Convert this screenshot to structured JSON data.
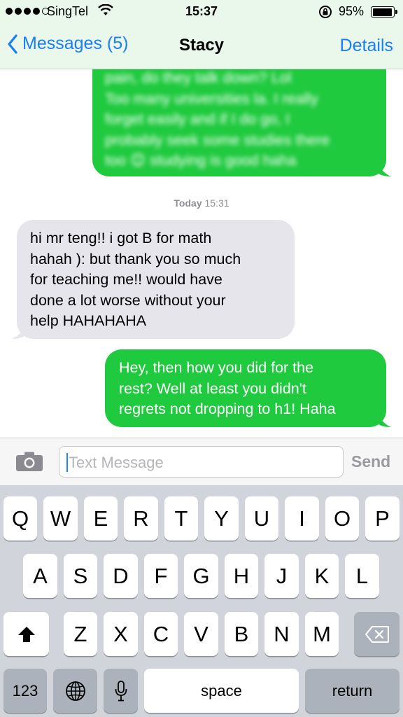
{
  "status": {
    "carrier": "SingTel",
    "time": "15:37",
    "battery": "95%",
    "signal_bars": 4,
    "signal_total": 5
  },
  "nav": {
    "back_label": "Messages (5)",
    "title": "Stacy",
    "details_label": "Details"
  },
  "messages": {
    "blurred_sent": {
      "lines": [
        "pain, do they talk down? Lol",
        "Too many universities la. I really",
        "forget easily and if I do go, I",
        "probably seek some studies there",
        "too 😊 studying is good haha"
      ]
    },
    "timestamp": {
      "day": "Today",
      "time": "15:31"
    },
    "received": {
      "lines": [
        "hi mr teng!! i got B for math",
        "hahah ): but thank you so much",
        "for teaching me!! would have",
        "done a lot worse without your",
        "help HAHAHAHA"
      ]
    },
    "sent": {
      "lines": [
        "Hey, then how you did for the",
        "rest? Well at least you didn't",
        "regrets not dropping to h1! Haha"
      ]
    }
  },
  "composer": {
    "placeholder": "Text Message",
    "send_label": "Send"
  },
  "keyboard": {
    "row1": [
      "Q",
      "W",
      "E",
      "R",
      "T",
      "Y",
      "U",
      "I",
      "O",
      "P"
    ],
    "row2": [
      "A",
      "S",
      "D",
      "F",
      "G",
      "H",
      "J",
      "K",
      "L"
    ],
    "row3": [
      "Z",
      "X",
      "C",
      "V",
      "B",
      "N",
      "M"
    ],
    "numbers_label": "123",
    "space_label": "space",
    "return_label": "return"
  },
  "colors": {
    "sent_bubble": "#1fca3e",
    "received_bubble": "#e6e5eb",
    "accent": "#1a7ef5"
  }
}
